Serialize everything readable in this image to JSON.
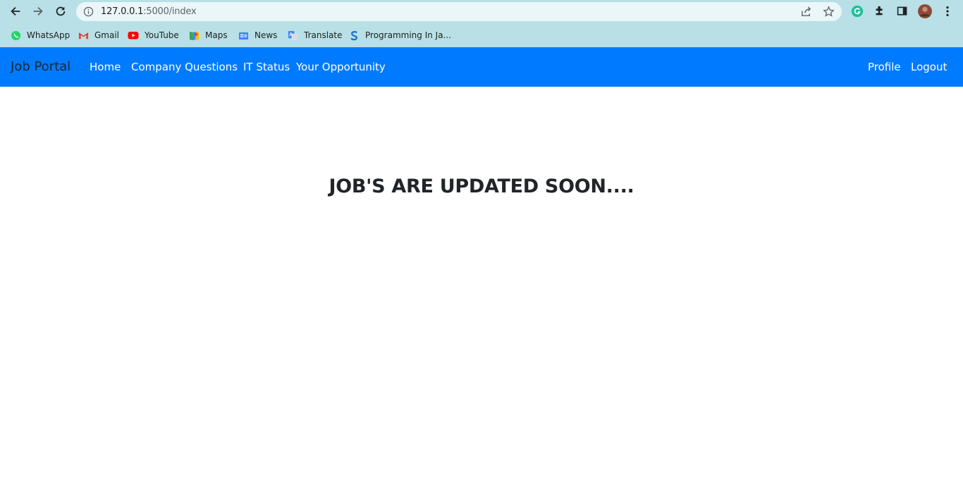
{
  "browser": {
    "url_host": "127.0.0.1",
    "url_path": ":5000/index",
    "bookmarks": [
      {
        "label": "WhatsApp",
        "icon": "whatsapp-icon"
      },
      {
        "label": "Gmail",
        "icon": "gmail-icon"
      },
      {
        "label": "YouTube",
        "icon": "youtube-icon"
      },
      {
        "label": "Maps",
        "icon": "maps-icon"
      },
      {
        "label": "News",
        "icon": "news-icon"
      },
      {
        "label": "Translate",
        "icon": "translate-icon"
      },
      {
        "label": "Programming In Ja...",
        "icon": "s-logo-icon"
      }
    ]
  },
  "navbar": {
    "brand": "Job Portal",
    "links": [
      "Home",
      "Company Questions",
      "IT Status",
      "Your Opportunity"
    ],
    "right_links": [
      "Profile",
      "Logout"
    ],
    "color": "#007bff"
  },
  "main": {
    "heading": "JOB'S ARE UPDATED SOON...."
  }
}
